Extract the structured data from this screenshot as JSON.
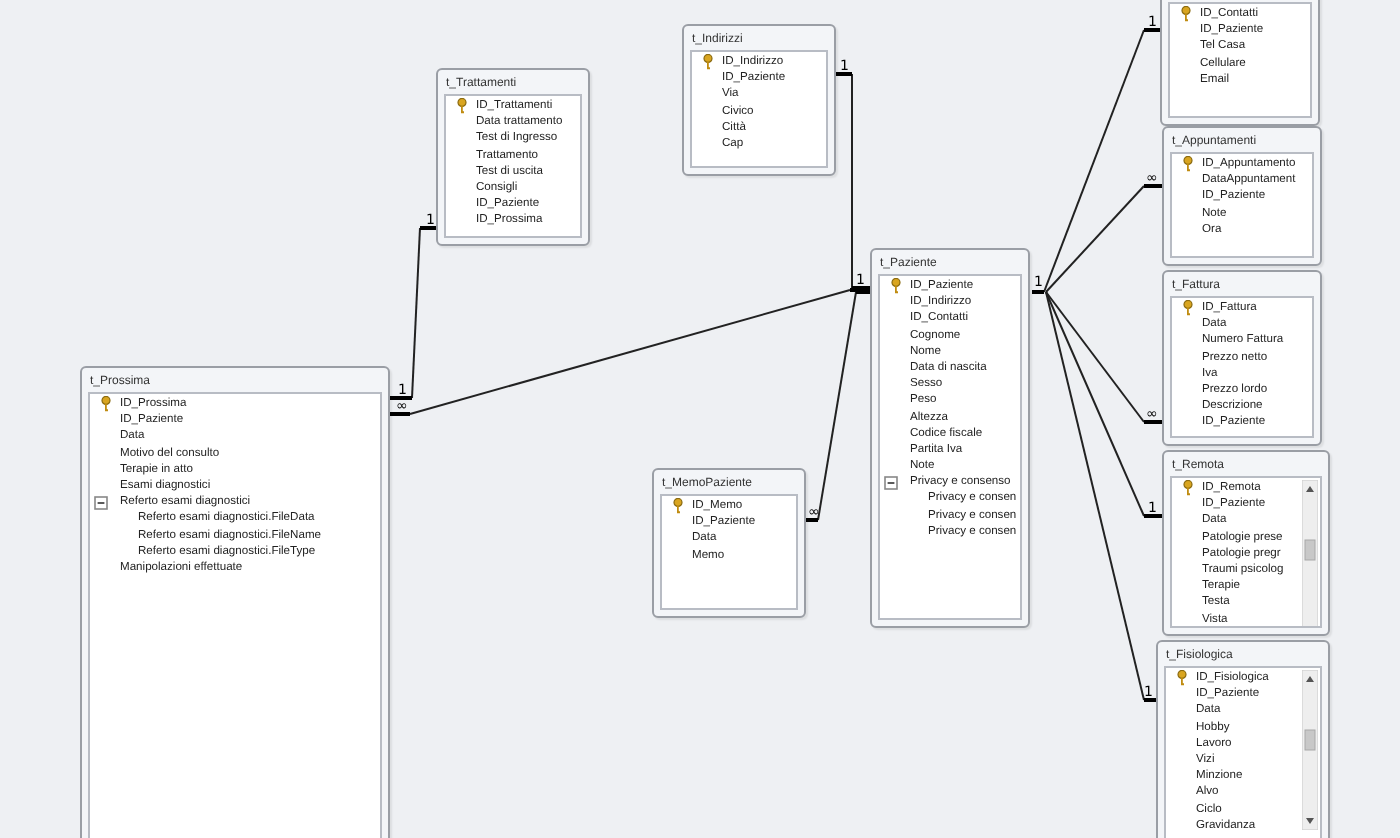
{
  "tables": [
    {
      "name": "t_Prossima",
      "fields": [
        {
          "name": "ID_Prossima",
          "primary_key": true
        },
        {
          "name": "ID_Paziente",
          "primary_key": false
        },
        {
          "name": "Data",
          "primary_key": false
        },
        {
          "name": "Motivo del consulto",
          "primary_key": false
        },
        {
          "name": "Terapie in atto",
          "primary_key": false
        },
        {
          "name": "Esami diagnostici",
          "primary_key": false
        },
        {
          "name": "Referto esami diagnostici",
          "primary_key": false,
          "expanded": true,
          "children": [
            {
              "name": "Referto esami diagnostici.FileData",
              "primary_key": false
            },
            {
              "name": "Referto esami diagnostici.FileName",
              "primary_key": false
            },
            {
              "name": "Referto esami diagnostici.FileType",
              "primary_key": false
            }
          ]
        },
        {
          "name": "Manipolazioni effettuate",
          "primary_key": false
        }
      ]
    },
    {
      "name": "t_Trattamenti",
      "fields": [
        {
          "name": "ID_Trattamenti",
          "primary_key": true
        },
        {
          "name": "Data trattamento",
          "primary_key": false
        },
        {
          "name": "Test di Ingresso",
          "primary_key": false
        },
        {
          "name": "Trattamento",
          "primary_key": false
        },
        {
          "name": "Test di uscita",
          "primary_key": false
        },
        {
          "name": "Consigli",
          "primary_key": false
        },
        {
          "name": "ID_Paziente",
          "primary_key": false
        },
        {
          "name": "ID_Prossima",
          "primary_key": false
        }
      ]
    },
    {
      "name": "t_Indirizzi",
      "fields": [
        {
          "name": "ID_Indirizzo",
          "primary_key": true
        },
        {
          "name": "ID_Paziente",
          "primary_key": false
        },
        {
          "name": "Via",
          "primary_key": false
        },
        {
          "name": "Civico",
          "primary_key": false
        },
        {
          "name": "Città",
          "primary_key": false
        },
        {
          "name": "Cap",
          "primary_key": false
        }
      ]
    },
    {
      "name": "t_MemoPaziente",
      "fields": [
        {
          "name": "ID_Memo",
          "primary_key": true
        },
        {
          "name": "ID_Paziente",
          "primary_key": false
        },
        {
          "name": "Data",
          "primary_key": false
        },
        {
          "name": "Memo",
          "primary_key": false
        }
      ]
    },
    {
      "name": "t_Paziente",
      "fields": [
        {
          "name": "ID_Paziente",
          "primary_key": true
        },
        {
          "name": "ID_Indirizzo",
          "primary_key": false
        },
        {
          "name": "ID_Contatti",
          "primary_key": false
        },
        {
          "name": "Cognome",
          "primary_key": false
        },
        {
          "name": "Nome",
          "primary_key": false
        },
        {
          "name": "Data di nascita",
          "primary_key": false
        },
        {
          "name": "Sesso",
          "primary_key": false
        },
        {
          "name": "Peso",
          "primary_key": false
        },
        {
          "name": "Altezza",
          "primary_key": false
        },
        {
          "name": "Codice fiscale",
          "primary_key": false
        },
        {
          "name": "Partita Iva",
          "primary_key": false
        },
        {
          "name": "Note",
          "primary_key": false
        },
        {
          "name": "Privacy e consenso",
          "primary_key": false,
          "expanded": true,
          "children": [
            {
              "name": "Privacy e consen",
              "primary_key": false
            },
            {
              "name": "Privacy e consen",
              "primary_key": false
            },
            {
              "name": "Privacy e consen",
              "primary_key": false
            }
          ]
        }
      ]
    },
    {
      "fields": [
        {
          "name": "ID_Contatti",
          "primary_key": true
        },
        {
          "name": "ID_Paziente",
          "primary_key": false
        },
        {
          "name": "Tel Casa",
          "primary_key": false
        },
        {
          "name": "Cellulare",
          "primary_key": false
        },
        {
          "name": "Email",
          "primary_key": false
        }
      ]
    },
    {
      "name": "t_Appuntamenti",
      "fields": [
        {
          "name": "ID_Appuntamento",
          "primary_key": true
        },
        {
          "name": "DataAppuntament",
          "primary_key": false
        },
        {
          "name": "ID_Paziente",
          "primary_key": false
        },
        {
          "name": "Note",
          "primary_key": false
        },
        {
          "name": "Ora",
          "primary_key": false
        }
      ]
    },
    {
      "name": "t_Fattura",
      "fields": [
        {
          "name": "ID_Fattura",
          "primary_key": true
        },
        {
          "name": "Data",
          "primary_key": false
        },
        {
          "name": "Numero Fattura",
          "primary_key": false
        },
        {
          "name": "Prezzo netto",
          "primary_key": false
        },
        {
          "name": "Iva",
          "primary_key": false
        },
        {
          "name": "Prezzo lordo",
          "primary_key": false
        },
        {
          "name": "Descrizione",
          "primary_key": false
        },
        {
          "name": "ID_Paziente",
          "primary_key": false
        }
      ]
    },
    {
      "name": "t_Remota",
      "scrollbar": true,
      "fields": [
        {
          "name": "ID_Remota",
          "primary_key": true
        },
        {
          "name": "ID_Paziente",
          "primary_key": false
        },
        {
          "name": "Data",
          "primary_key": false
        },
        {
          "name": "Patologie prese",
          "primary_key": false
        },
        {
          "name": "Patologie pregr",
          "primary_key": false
        },
        {
          "name": "Traumi psicolog",
          "primary_key": false
        },
        {
          "name": "Terapie",
          "primary_key": false
        },
        {
          "name": "Testa",
          "primary_key": false
        },
        {
          "name": "Vista",
          "primary_key": false
        }
      ]
    },
    {
      "name": "t_Fisiologica",
      "scrollbar": true,
      "fields": [
        {
          "name": "ID_Fisiologica",
          "primary_key": true
        },
        {
          "name": "ID_Paziente",
          "primary_key": false
        },
        {
          "name": "Data",
          "primary_key": false
        },
        {
          "name": "Hobby",
          "primary_key": false
        },
        {
          "name": "Lavoro",
          "primary_key": false
        },
        {
          "name": "Vizi",
          "primary_key": false
        },
        {
          "name": "Minzione",
          "primary_key": false
        },
        {
          "name": "Alvo",
          "primary_key": false
        },
        {
          "name": "Ciclo",
          "primary_key": false
        },
        {
          "name": "Gravidanza",
          "primary_key": false
        }
      ]
    }
  ],
  "relationships": [
    {
      "from_label": "1",
      "to_label": "1"
    },
    {
      "from_label": "∞",
      "to_label": "1"
    },
    {
      "from_label": "1"
    },
    {
      "from_label": "∞"
    },
    {
      "from_label": "1",
      "to_label": "1"
    },
    {
      "to_label": "∞"
    },
    {
      "to_label": "∞"
    },
    {
      "to_label": "1"
    },
    {
      "to_label": "1"
    }
  ]
}
